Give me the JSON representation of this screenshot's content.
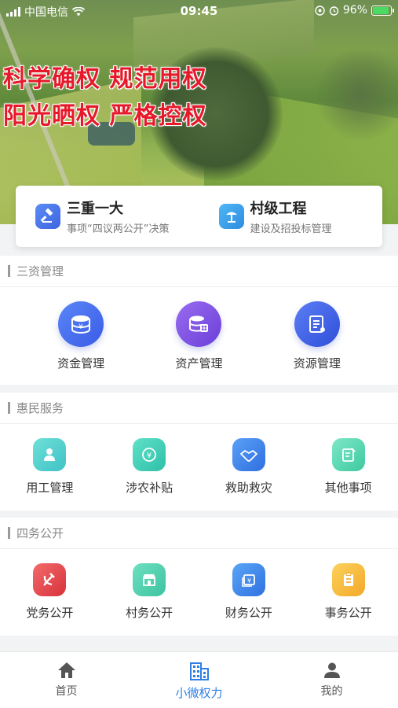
{
  "status_bar": {
    "carrier": "中国电信",
    "time": "09:45",
    "battery": "96%"
  },
  "banner": {
    "line1": "科学确权 规范用权",
    "line2": "阳光晒权 严格控权"
  },
  "quick_links": [
    {
      "title": "三重一大",
      "subtitle": "事项“四议两公开”决策",
      "icon": "gavel-icon"
    },
    {
      "title": "村级工程",
      "subtitle": "建设及招投标管理",
      "icon": "construction-icon"
    }
  ],
  "sections": [
    {
      "title": "三资管理",
      "items": [
        {
          "label": "资金管理",
          "icon": "coin-stack-icon"
        },
        {
          "label": "资产管理",
          "icon": "asset-database-icon"
        },
        {
          "label": "资源管理",
          "icon": "document-icon"
        }
      ]
    },
    {
      "title": "惠民服务",
      "items": [
        {
          "label": "用工管理",
          "icon": "worker-icon"
        },
        {
          "label": "涉农补贴",
          "icon": "subsidy-icon"
        },
        {
          "label": "救助救灾",
          "icon": "handshake-icon"
        },
        {
          "label": "其他事项",
          "icon": "note-edit-icon"
        }
      ]
    },
    {
      "title": "四务公开",
      "items": [
        {
          "label": "党务公开",
          "icon": "party-emblem-icon"
        },
        {
          "label": "村务公开",
          "icon": "village-store-icon"
        },
        {
          "label": "财务公开",
          "icon": "finance-window-icon"
        },
        {
          "label": "事务公开",
          "icon": "clipboard-icon"
        }
      ]
    }
  ],
  "tabs": [
    {
      "label": "首页",
      "icon": "home-icon",
      "active": false
    },
    {
      "label": "小微权力",
      "icon": "building-icon",
      "active": true
    },
    {
      "label": "我的",
      "icon": "user-icon",
      "active": false
    }
  ],
  "colors": {
    "accent": "#2f7fe6",
    "slogan_red": "#e6192a"
  }
}
